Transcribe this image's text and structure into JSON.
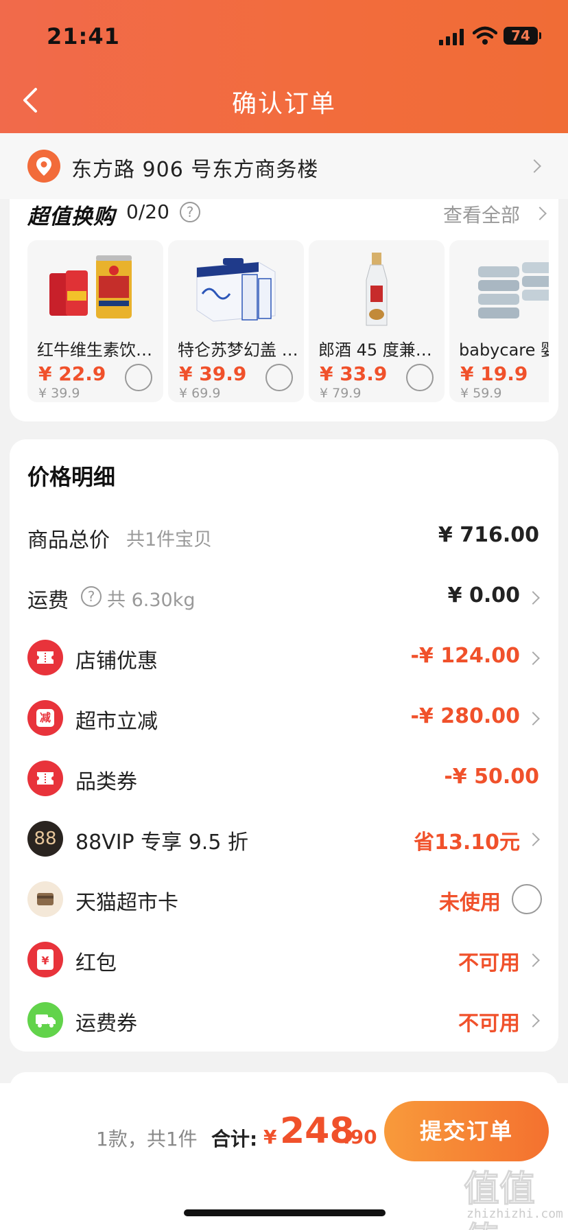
{
  "status_bar": {
    "time": "21:41",
    "battery": "74"
  },
  "header": {
    "title": "确认订单"
  },
  "address": {
    "text": "东方路 906 号东方商务楼"
  },
  "swap": {
    "title": "超值换购",
    "count": "0/20",
    "help": "?",
    "view_all": "查看全部",
    "products": [
      {
        "name": "红牛维生素饮…",
        "price": "¥ 22.9",
        "original": "¥ 39.9"
      },
      {
        "name": "特仑苏梦幻盖 …",
        "price": "¥ 39.9",
        "original": "¥ 69.9"
      },
      {
        "name": "郎酒 45 度兼…",
        "price": "¥ 33.9",
        "original": "¥ 79.9"
      },
      {
        "name": "babycare 婴",
        "price": "¥ 19.9",
        "original": "¥ 59.9"
      }
    ]
  },
  "price_detail": {
    "title": "价格明细",
    "rows": [
      {
        "label": "商品总价",
        "sub": "共1件宝贝",
        "value": "¥ 716.00"
      },
      {
        "label": "运费",
        "help": "?",
        "sub": "共 6.30kg",
        "value": "¥ 0.00"
      },
      {
        "label": "店铺优惠",
        "value": "-¥ 124.00",
        "icon": "coupon-icon"
      },
      {
        "label": "超市立减",
        "value": "-¥ 280.00",
        "icon": "reduce-icon",
        "icon_text": "减"
      },
      {
        "label": "品类券",
        "value": "-¥ 50.00",
        "icon": "coupon-icon"
      },
      {
        "label": "88VIP 专享 9.5 折",
        "value": "省13.10元",
        "icon": "vip-88-icon",
        "icon_text": "88"
      },
      {
        "label": "天猫超市卡",
        "value": "未使用",
        "icon": "card-icon"
      },
      {
        "label": "红包",
        "value": "不可用",
        "icon": "red-packet-icon",
        "icon_text": "¥"
      },
      {
        "label": "运费券",
        "value": "不可用",
        "icon": "truck-icon"
      }
    ]
  },
  "bottom": {
    "summary": "1款，共1件",
    "total_label": "合计:",
    "currency": "¥",
    "total_int": "248",
    "total_dec": ".90",
    "submit": "提交订单"
  },
  "watermark": {
    "glyphs": "值值值",
    "url": "zhizhizhi.com"
  },
  "colors": {
    "accent": "#f0512b",
    "header": "#f26c3c",
    "button": "#f4712f"
  }
}
